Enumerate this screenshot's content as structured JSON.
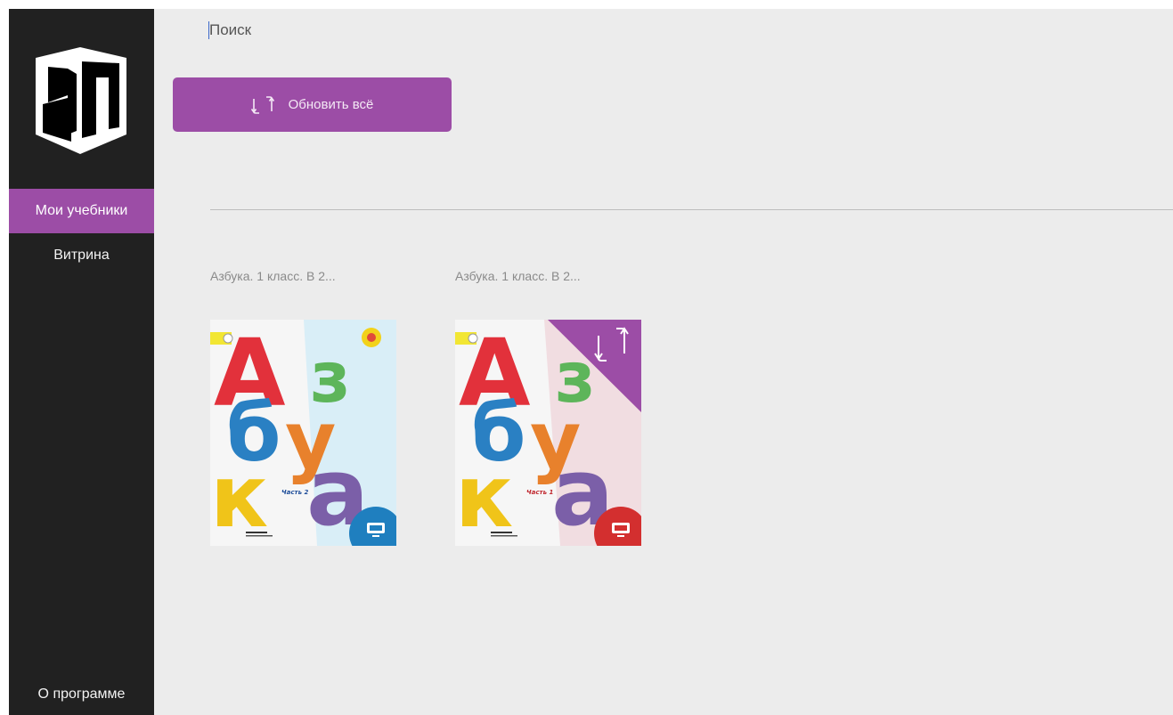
{
  "sidebar": {
    "items": [
      {
        "label": "Мои учебники",
        "active": true
      },
      {
        "label": "Витрина",
        "active": false
      }
    ],
    "about_label": "О программе"
  },
  "search": {
    "placeholder": "Поиск",
    "value": ""
  },
  "toolbar": {
    "update_all_label": "Обновить всё",
    "update_icon": "sync-icon"
  },
  "books": [
    {
      "title": "Азбука. 1 класс. В 2...",
      "cover_part": "Часть 2",
      "cover_letters": [
        "А",
        "з",
        "б",
        "у",
        "к",
        "а"
      ],
      "needs_update": false,
      "badge_color": "#1f7fbf"
    },
    {
      "title": "Азбука. 1 класс. В 2...",
      "cover_part": "Часть 1",
      "cover_letters": [
        "А",
        "з",
        "б",
        "у",
        "к",
        "а"
      ],
      "needs_update": true,
      "badge_color": "#d32f2f"
    }
  ],
  "colors": {
    "accent": "#9c4da6",
    "sidebar_bg": "#212121",
    "content_bg": "#ececec"
  }
}
